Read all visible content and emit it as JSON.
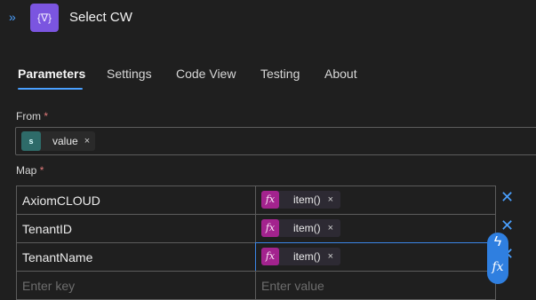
{
  "header": {
    "title": "Select CW",
    "expand_icon": "double-chevron-right-icon",
    "app_icon_glyph": "{∇}"
  },
  "tabs": [
    {
      "label": "Parameters",
      "active": true
    },
    {
      "label": "Settings"
    },
    {
      "label": "Code View"
    },
    {
      "label": "Testing"
    },
    {
      "label": "About"
    }
  ],
  "from": {
    "label": "From",
    "required_mark": "*",
    "token": {
      "icon_text": "s",
      "text": "value",
      "remove": "×"
    }
  },
  "map": {
    "label": "Map",
    "required_mark": "*",
    "rows": [
      {
        "key": "AxiomCLOUD",
        "value_token": "item()",
        "remove": "×"
      },
      {
        "key": "TenantID",
        "value_token": "item()",
        "remove": "×"
      },
      {
        "key": "TenantName",
        "value_token": "item()",
        "remove": "×"
      }
    ],
    "new_row": {
      "key_placeholder": "Enter key",
      "value_placeholder": "Enter value"
    },
    "fx_label": "fx",
    "row_remove_glyph": "✕"
  },
  "floating_buttons": {
    "lightning_glyph": "ϟ",
    "fx_glyph": "fx"
  },
  "colors": {
    "accent": "#4aa0ff",
    "app_icon": "#7b55e0",
    "fx_token": "#a3238e",
    "sharepoint": "#2e6b69"
  }
}
